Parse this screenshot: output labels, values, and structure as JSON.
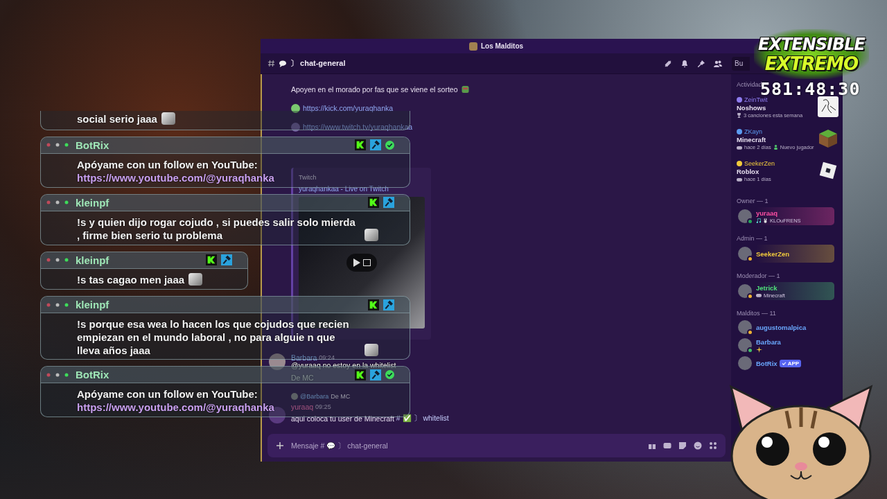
{
  "overlay_chat": {
    "messages": [
      {
        "kind": "partial",
        "text": "social serio jaaa",
        "has_emote": true
      },
      {
        "kind": "full",
        "user": "BotRix",
        "text": "Apóyame con un follow en YouTube:",
        "link": "https://www.youtube.com/@yuraqhanka",
        "has_emote": false,
        "badges": [
          {
            "kind": "kick"
          },
          {
            "kind": "mod"
          },
          {
            "kind": "verified"
          }
        ]
      },
      {
        "kind": "full",
        "user": "kleinpf",
        "text": "!s y quien dijo rogar cojudo , si puedes salir solo mierda , firme bien serio tu problema",
        "has_emote": true,
        "badges": [
          {
            "kind": "kick"
          },
          {
            "kind": "mod"
          }
        ]
      },
      {
        "kind": "full",
        "user": "kleinpf",
        "text": "!s tas cagao men jaaa",
        "has_emote": true,
        "badges": [
          {
            "kind": "kick"
          },
          {
            "kind": "mod"
          }
        ]
      },
      {
        "kind": "full",
        "user": "kleinpf",
        "text": "!s porque esa wea lo hacen los que cojudos que recien empiezan en el mundo laboral , no para alguie n que lleva años jaaa",
        "has_emote": true,
        "badges": [
          {
            "kind": "kick"
          },
          {
            "kind": "mod"
          }
        ]
      },
      {
        "kind": "full",
        "user": "BotRix",
        "text": "Apóyame con un follow en YouTube:",
        "link": "https://www.youtube.com/@yuraqhanka",
        "has_emote": false,
        "badges": [
          {
            "kind": "kick"
          },
          {
            "kind": "mod"
          },
          {
            "kind": "verified"
          }
        ]
      }
    ]
  },
  "discord": {
    "window_title": "Los Malditos",
    "channel": "〕 chat-general",
    "search": {
      "placeholder": "Bu"
    },
    "messages": [
      {
        "kind": "text",
        "text": "Apoyen en el morado por fas que se viene el sorteo"
      },
      {
        "kind": "link",
        "text": "https://kick.com/yuraqhanka",
        "color": "#7bc96f"
      },
      {
        "kind": "link",
        "text": "https://www.twitch.tv/yuraqhankaa",
        "color": "#6e5a9a"
      },
      {
        "kind": "embed",
        "provider": "Twitch",
        "title": "yuraqhankaa - Live on Twitch"
      },
      {
        "kind": "post",
        "author": "Barbara",
        "time": "09:24",
        "lines": [
          "@yuraaq  no estoy en la whitelist",
          "De MC"
        ]
      },
      {
        "kind": "reply",
        "reply_to": "@Barbara",
        "reply_text": "De MC",
        "author": "yuraaq",
        "time": "09:25",
        "text": "aqui coloca tu user de Minecraft",
        "mention": "# ✅ 〕 whitelist"
      }
    ],
    "composer": {
      "placeholder": "Mensaje # 💬 〕 chat-general"
    },
    "sidebar": {
      "activity_header": "Actividad",
      "activities": [
        {
          "kind": "sketch",
          "user": "ZeinTwit",
          "color": "#8e7cf0",
          "title": "Noshows",
          "detail": "3 canciones esta semana"
        },
        {
          "kind": "grass-block",
          "user": "ZKayn",
          "color": "#5b9bf0",
          "title": "Minecraft",
          "detail": "hace 2 días",
          "extra": "Nuevo jugador"
        },
        {
          "kind": "roblox",
          "user": "SeekerZen",
          "color": "#f0c93c",
          "title": "Roblox",
          "detail": "hace 1 días"
        }
      ],
      "groups": [
        {
          "title": "Owner — 1",
          "members": [
            {
              "name": "yuraaq",
              "color": "#ff4fa3",
              "kind": "online",
              "banner": true,
              "status": "KLOuFRENS"
            }
          ]
        },
        {
          "title": "Admin — 1",
          "members": [
            {
              "name": "SeekerZen",
              "color": "#f0c93c",
              "kind": "idle",
              "banner": true
            }
          ]
        },
        {
          "title": "Moderador — 1",
          "members": [
            {
              "name": "Jetrick",
              "color": "#4fe07a",
              "kind": "idle",
              "banner": true,
              "activity": "Minecraft"
            }
          ]
        },
        {
          "title": "Malditos — 11",
          "members": [
            {
              "name": "augustomalpica",
              "color": "#6aa8ff",
              "kind": "idle",
              "banner": false
            },
            {
              "name": "Barbara",
              "color": "#6aa8ff",
              "kind": "mobile",
              "banner": false,
              "sparkle": true
            },
            {
              "name": "BotRix",
              "color": "#6aa8ff",
              "kind": "plain",
              "banner": false,
              "app_badge": "APP"
            }
          ]
        }
      ]
    }
  },
  "logo": {
    "line_1": "EXTENSIBLE",
    "line_2": "EXTREMO"
  },
  "timer": "581:48:30"
}
